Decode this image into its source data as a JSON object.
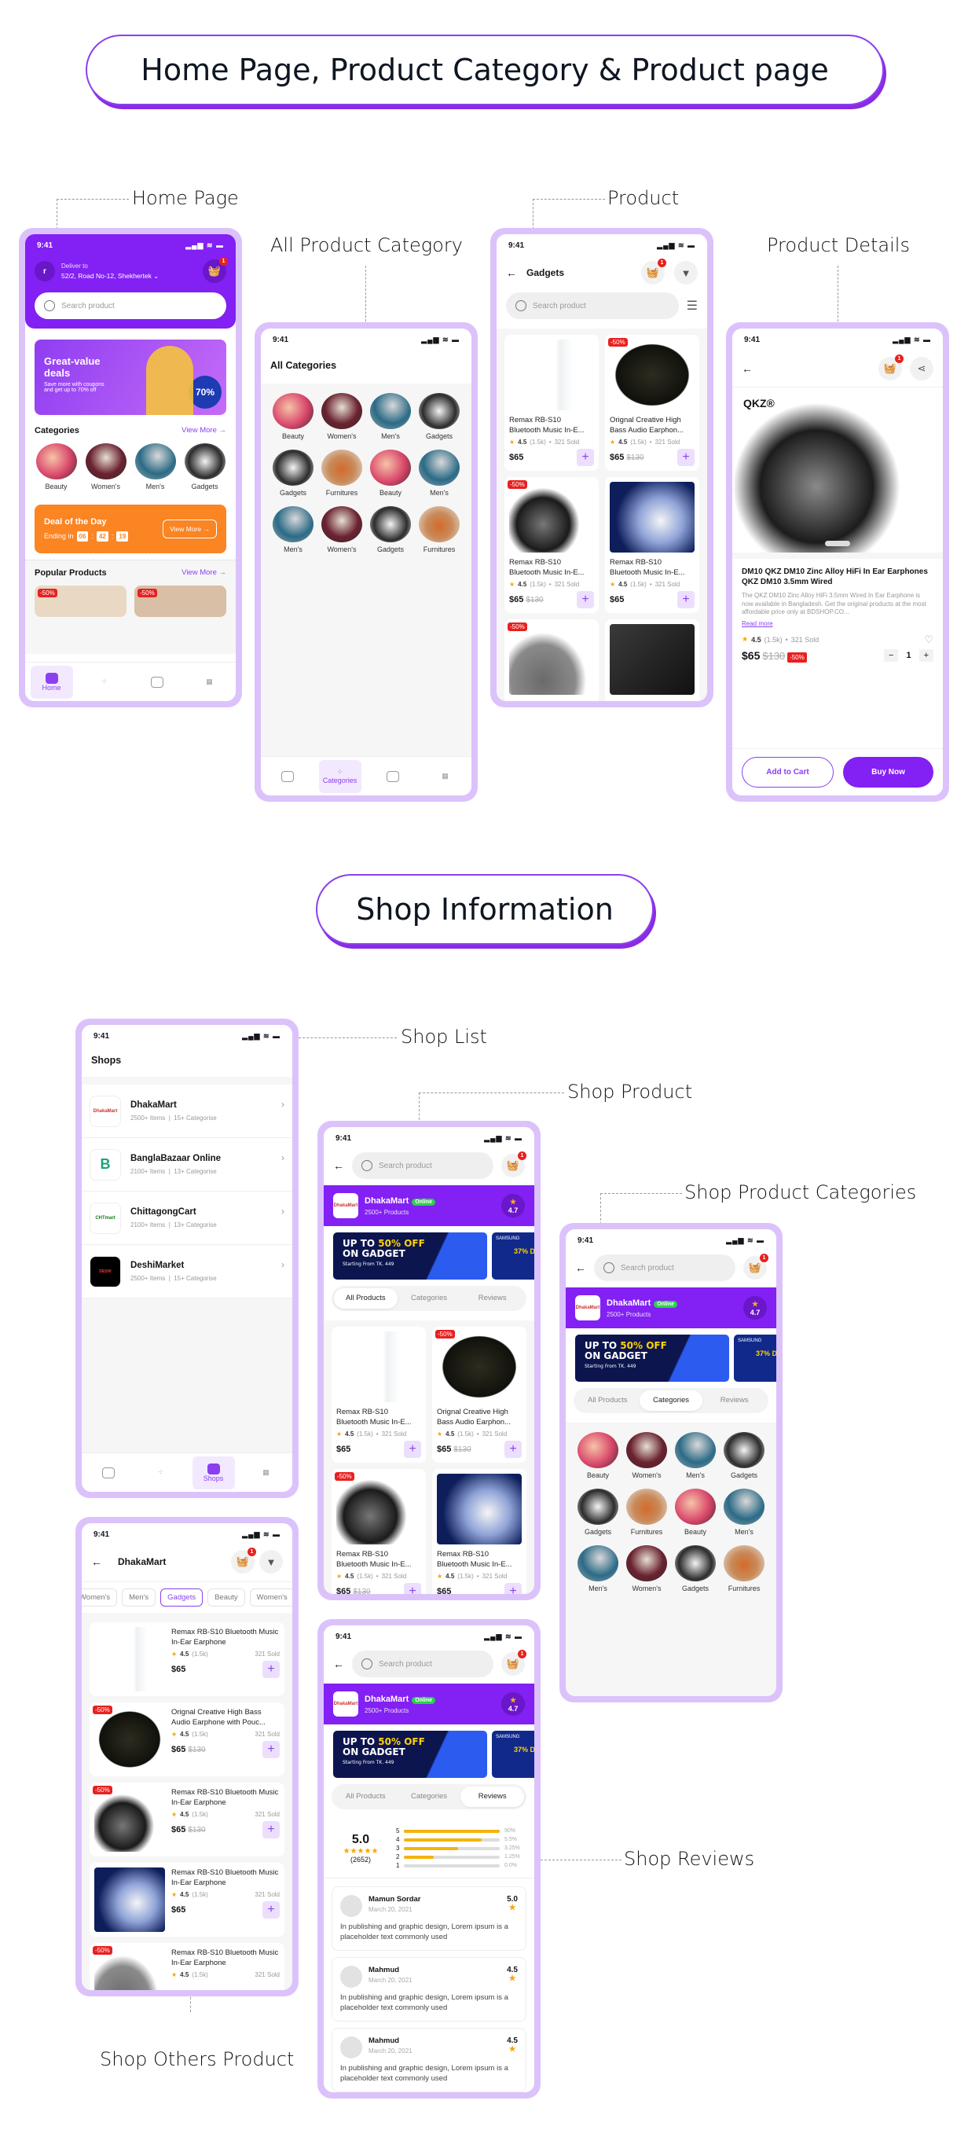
{
  "sections": {
    "section1_title": "Home Page, Product Category & Product page",
    "section2_title": "Shop Information"
  },
  "labels": {
    "home_page": "Home Page",
    "all_product_category": "All Product Category",
    "product": "Product",
    "product_details": "Product Details",
    "shop_list": "Shop List",
    "shop_product": "Shop Product",
    "shop_product_categories": "Shop Product Categories",
    "shop_reviews": "Shop Reviews",
    "shop_others_product": "Shop Others Product"
  },
  "status_time": "9:41",
  "status_icons": "▂▄▆ ≋ ▬",
  "colors": {
    "accent": "#8320f3",
    "frame": "#dcc2fb",
    "orange": "#fb8423",
    "discount": "#e8201f",
    "star": "#f5a60a",
    "online": "#2bd04d"
  },
  "home": {
    "deliver_label": "Deliver to",
    "address": "52/2, Road No-12, Shekhertek ⌄",
    "cart_count": "1",
    "search_placeholder": "Search product",
    "hero_title": "Great-value deals",
    "hero_sub": "Save more with coupons and get up to 70% off",
    "hero_badge": "70%",
    "categories_title": "Categories",
    "view_more": "View More →",
    "categories": [
      "Beauty",
      "Women's",
      "Men's",
      "Gadgets"
    ],
    "deal_title": "Deal of the Day",
    "deal_ending": "Ending in",
    "timer": [
      "06",
      "42",
      "19"
    ],
    "deal_button": "View More →",
    "popular_title": "Popular Products",
    "popular_discounts": [
      "-50%",
      "-50%"
    ]
  },
  "nav": {
    "home": "Home",
    "categories": "Categories",
    "shops": "Shops"
  },
  "all_categories": {
    "title": "All Categories",
    "items": [
      "Beauty",
      "Women's",
      "Men's",
      "Gadgets",
      "Gadgets",
      "Furnitures",
      "Beauty",
      "Men's",
      "Men's",
      "Women's",
      "Gadgets",
      "Furnitures"
    ]
  },
  "product_list": {
    "title": "Gadgets",
    "cart_count": "1",
    "search_placeholder": "Search product",
    "products": [
      {
        "name": "Remax RB-S10 Bluetooth Music In-E...",
        "rating": "4.5",
        "reviews": "(1.5k)",
        "sold": "321 Sold",
        "price": "$65",
        "old_price": "",
        "discount": ""
      },
      {
        "name": "Orignal Creative High Bass Audio Earphon...",
        "rating": "4.5",
        "reviews": "(1.5k)",
        "sold": "321 Sold",
        "price": "$65",
        "old_price": "$130",
        "discount": "-50%"
      },
      {
        "name": "Remax RB-S10 Bluetooth Music In-E...",
        "rating": "4.5",
        "reviews": "(1.5k)",
        "sold": "321 Sold",
        "price": "$65",
        "old_price": "$130",
        "discount": "-50%"
      },
      {
        "name": "Remax RB-S10 Bluetooth Music In-E...",
        "rating": "4.5",
        "reviews": "(1.5k)",
        "sold": "321 Sold",
        "price": "$65",
        "old_price": "",
        "discount": ""
      },
      {
        "name": "",
        "discount": "-50%"
      },
      {
        "name": "",
        "discount": ""
      }
    ]
  },
  "product_details": {
    "cart_count": "1",
    "brand": "QKZ®",
    "title": "DM10 QKZ DM10 Zinc Alloy HiFi In Ear Earphones QKZ DM10 3.5mm Wired",
    "description": "The QKZ DM10 Zinc Alloy HiFi 3.5mm Wired In Ear Earphone is now available in Bangladesh. Get the original products at the most affordable price only at BDSHOP.CO...",
    "read_more": "Read more",
    "rating": "4.5",
    "reviews": "(1.5k)",
    "sold": "321 Sold",
    "price": "$65",
    "old_price": "$130",
    "discount": "-50%",
    "quantity": "1",
    "add_to_cart": "Add to Cart",
    "buy_now": "Buy Now"
  },
  "shops": {
    "title": "Shops",
    "list": [
      {
        "name": "DhakaMart",
        "items": "2500+ Items",
        "cats": "15+ Categorise",
        "logo": "DhakaMart"
      },
      {
        "name": "BanglaBazaar Online",
        "items": "2100+ Items",
        "cats": "13+ Categorise",
        "logo": "B"
      },
      {
        "name": "ChittagongCart",
        "items": "2100+ Items",
        "cats": "13+ Categorise",
        "logo": "CHTmart"
      },
      {
        "name": "DeshiMarket",
        "items": "2500+ Items",
        "cats": "15+ Categorise",
        "logo": "DESHI"
      }
    ]
  },
  "shop_page": {
    "search_placeholder": "Search product",
    "cart_count": "1",
    "name": "DhakaMart",
    "status": "Online",
    "products_count": "2500+ Products",
    "rating": "4.7",
    "banner_line1": "UP TO",
    "banner_highlight": "50% OFF",
    "banner_line2": "ON GADGET",
    "banner_sub": "Starting From TK. 449",
    "banner2_brand": "SAMSUNG",
    "banner2_text": "37% D",
    "tabs": [
      "All Products",
      "Categories",
      "Reviews"
    ]
  },
  "reviews": {
    "average": "5.0",
    "count": "(2652)",
    "distribution": [
      {
        "star": "5",
        "pct": "90%",
        "value": 1.0
      },
      {
        "star": "4",
        "pct": "5.5%",
        "value": 0.81
      },
      {
        "star": "3",
        "pct": "3.25%",
        "value": 0.56
      },
      {
        "star": "2",
        "pct": "1.25%",
        "value": 0.31
      },
      {
        "star": "1",
        "pct": "0.0%",
        "value": 0.0
      }
    ],
    "items": [
      {
        "name": "Mamun Sordar",
        "date": "March 20, 2021",
        "score": "5.0",
        "text": "In publishing and graphic design, Lorem ipsum is a placeholder text commonly used"
      },
      {
        "name": "Mahmud",
        "date": "March 20, 2021",
        "score": "4.5",
        "text": "In publishing and graphic design, Lorem ipsum is a placeholder text commonly used"
      },
      {
        "name": "Mahmud",
        "date": "March 20, 2021",
        "score": "4.5",
        "text": "In publishing and graphic design, Lorem ipsum is a placeholder text commonly used"
      }
    ]
  },
  "shop_others": {
    "title": "DhakaMart",
    "cart_count": "1",
    "chips": [
      "Women's",
      "Men's",
      "Gadgets",
      "Beauty",
      "Women's"
    ],
    "active_chip": "Gadgets",
    "products": [
      {
        "name": "Remax RB-S10 Bluetooth Music In-Ear Earphone",
        "rating": "4.5",
        "reviews": "(1.5k)",
        "sold": "321 Sold",
        "price": "$65",
        "old_price": "",
        "discount": ""
      },
      {
        "name": "Orignal Creative High Bass Audio Earphone with Pouc...",
        "rating": "4.5",
        "reviews": "(1.5k)",
        "sold": "321 Sold",
        "price": "$65",
        "old_price": "$130",
        "discount": "-50%"
      },
      {
        "name": "Remax RB-S10 Bluetooth Music In-Ear Earphone",
        "rating": "4.5",
        "reviews": "(1.5k)",
        "sold": "321 Sold",
        "price": "$65",
        "old_price": "$130",
        "discount": "-50%"
      },
      {
        "name": "Remax RB-S10 Bluetooth Music In-Ear Earphone",
        "rating": "4.5",
        "reviews": "(1.5k)",
        "sold": "321 Sold",
        "price": "$65",
        "old_price": "",
        "discount": ""
      },
      {
        "name": "Remax RB-S10 Bluetooth Music In-Ear Earphone",
        "rating": "4.5",
        "reviews": "(1.5k)",
        "sold": "321 Sold",
        "price": "",
        "old_price": "",
        "discount": "-50%"
      }
    ]
  }
}
